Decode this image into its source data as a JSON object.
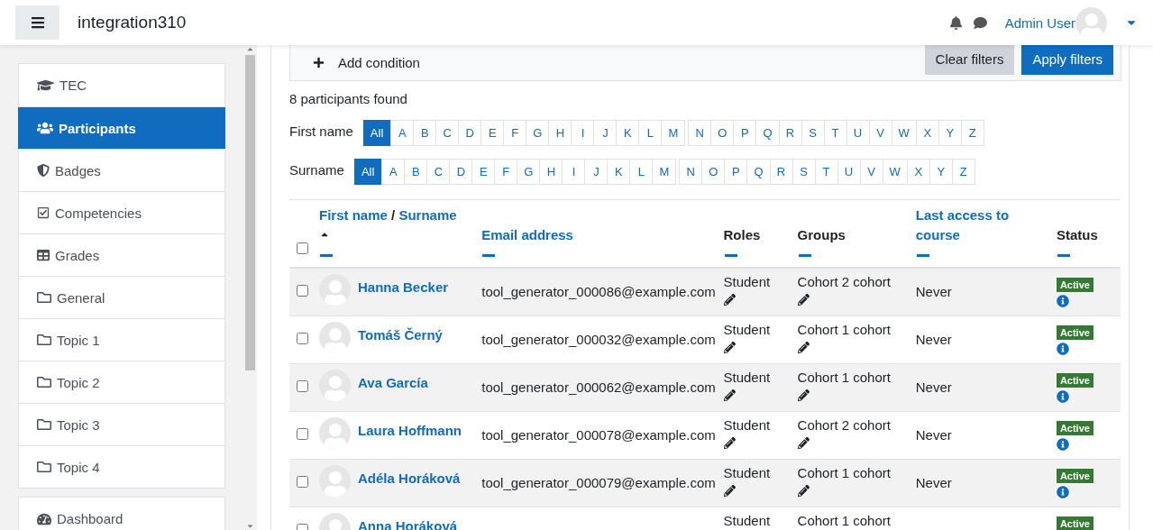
{
  "header": {
    "site_name": "integration310",
    "user_name": "Admin User"
  },
  "sidebar": {
    "items": [
      {
        "label": "TEC",
        "kind": "course",
        "selected": false
      },
      {
        "label": "Participants",
        "kind": "participants",
        "selected": true
      },
      {
        "label": "Badges",
        "kind": "badges",
        "selected": false
      },
      {
        "label": "Competencies",
        "kind": "competencies",
        "selected": false
      },
      {
        "label": "Grades",
        "kind": "grades",
        "selected": false
      },
      {
        "label": "General",
        "kind": "section",
        "selected": false
      },
      {
        "label": "Topic 1",
        "kind": "section",
        "selected": false
      },
      {
        "label": "Topic 2",
        "kind": "section",
        "selected": false
      },
      {
        "label": "Topic 3",
        "kind": "section",
        "selected": false
      },
      {
        "label": "Topic 4",
        "kind": "section",
        "selected": false
      }
    ],
    "bottom_items": [
      {
        "label": "Dashboard",
        "kind": "dashboard",
        "selected": false
      }
    ]
  },
  "filters": {
    "add_condition": "Add condition",
    "clear_button": "Clear filters",
    "apply_button": "Apply filters"
  },
  "participants_found": "8 participants found",
  "initials_bars": [
    {
      "label": "First name",
      "options": [
        {
          "label": "All",
          "selected": true
        },
        {
          "label": "A",
          "selected": false
        },
        {
          "label": "B",
          "selected": false
        },
        {
          "label": "C",
          "selected": false
        },
        {
          "label": "D",
          "selected": false
        },
        {
          "label": "E",
          "selected": false
        },
        {
          "label": "F",
          "selected": false
        },
        {
          "label": "G",
          "selected": false
        },
        {
          "label": "H",
          "selected": false
        },
        {
          "label": "I",
          "selected": false
        },
        {
          "label": "J",
          "selected": false
        },
        {
          "label": "K",
          "selected": false
        },
        {
          "label": "L",
          "selected": false
        },
        {
          "label": "M",
          "selected": false
        },
        {
          "label": "N",
          "selected": false
        },
        {
          "label": "O",
          "selected": false
        },
        {
          "label": "P",
          "selected": false
        },
        {
          "label": "Q",
          "selected": false
        },
        {
          "label": "R",
          "selected": false
        },
        {
          "label": "S",
          "selected": false
        },
        {
          "label": "T",
          "selected": false
        },
        {
          "label": "U",
          "selected": false
        },
        {
          "label": "V",
          "selected": false
        },
        {
          "label": "W",
          "selected": false
        },
        {
          "label": "X",
          "selected": false
        },
        {
          "label": "Y",
          "selected": false
        },
        {
          "label": "Z",
          "selected": false
        }
      ]
    },
    {
      "label": "Surname",
      "options": [
        {
          "label": "All",
          "selected": true
        },
        {
          "label": "A",
          "selected": false
        },
        {
          "label": "B",
          "selected": false
        },
        {
          "label": "C",
          "selected": false
        },
        {
          "label": "D",
          "selected": false
        },
        {
          "label": "E",
          "selected": false
        },
        {
          "label": "F",
          "selected": false
        },
        {
          "label": "G",
          "selected": false
        },
        {
          "label": "H",
          "selected": false
        },
        {
          "label": "I",
          "selected": false
        },
        {
          "label": "J",
          "selected": false
        },
        {
          "label": "K",
          "selected": false
        },
        {
          "label": "L",
          "selected": false
        },
        {
          "label": "M",
          "selected": false
        },
        {
          "label": "N",
          "selected": false
        },
        {
          "label": "O",
          "selected": false
        },
        {
          "label": "P",
          "selected": false
        },
        {
          "label": "Q",
          "selected": false
        },
        {
          "label": "R",
          "selected": false
        },
        {
          "label": "S",
          "selected": false
        },
        {
          "label": "T",
          "selected": false
        },
        {
          "label": "U",
          "selected": false
        },
        {
          "label": "V",
          "selected": false
        },
        {
          "label": "W",
          "selected": false
        },
        {
          "label": "X",
          "selected": false
        },
        {
          "label": "Y",
          "selected": false
        },
        {
          "label": "Z",
          "selected": false
        }
      ]
    }
  ],
  "table": {
    "select_all_checked": false,
    "columns": [
      {
        "labels": [
          "First name",
          "Surname"
        ],
        "separator": "/",
        "kind": "link",
        "sorted": true
      },
      {
        "labels": [
          "Email address"
        ],
        "kind": "link",
        "sorted": false
      },
      {
        "labels": [
          "Roles"
        ],
        "kind": "plain",
        "sorted": false
      },
      {
        "labels": [
          "Groups"
        ],
        "kind": "plain",
        "sorted": false
      },
      {
        "labels": [
          "Last access to course"
        ],
        "kind": "link",
        "sorted": false
      },
      {
        "labels": [
          "Status"
        ],
        "kind": "plain",
        "sorted": false
      }
    ],
    "rows": [
      {
        "checked": false,
        "name": "Hanna Becker",
        "email": "tool_generator_000086@example.com",
        "role": "Student",
        "group": "Cohort 2 cohort",
        "last_access": "Never",
        "status": "Active"
      },
      {
        "checked": false,
        "name": "Tomáš Černý",
        "email": "tool_generator_000032@example.com",
        "role": "Student",
        "group": "Cohort 1 cohort",
        "last_access": "Never",
        "status": "Active"
      },
      {
        "checked": false,
        "name": "Ava García",
        "email": "tool_generator_000062@example.com",
        "role": "Student",
        "group": "Cohort 1 cohort",
        "last_access": "Never",
        "status": "Active"
      },
      {
        "checked": false,
        "name": "Laura Hoffmann",
        "email": "tool_generator_000078@example.com",
        "role": "Student",
        "group": "Cohort 2 cohort",
        "last_access": "Never",
        "status": "Active"
      },
      {
        "checked": false,
        "name": "Adéla Horáková",
        "email": "tool_generator_000079@example.com",
        "role": "Student",
        "group": "Cohort 1 cohort",
        "last_access": "Never",
        "status": "Active"
      },
      {
        "checked": false,
        "name": "Anna Horáková",
        "role": "Student",
        "group": "Cohort 1 cohort",
        "status": "Active"
      }
    ]
  }
}
